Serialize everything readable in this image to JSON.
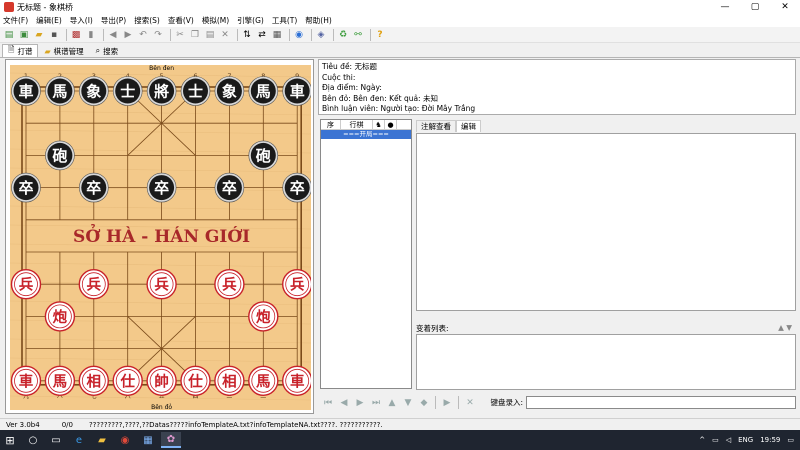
{
  "window": {
    "title": "无标题 - 象棋桥",
    "minimize": "—",
    "maximize": "▢",
    "close": "✕"
  },
  "menu": [
    "文件(F)",
    "编辑(E)",
    "导入(I)",
    "导出(P)",
    "搜索(S)",
    "查看(V)",
    "模拟(M)",
    "引擎(G)",
    "工具(T)",
    "帮助(H)"
  ],
  "toolbar_icons": [
    "new-icon",
    "open-icon",
    "folder-icon",
    "save-icon",
    "print-icon",
    "delete-icon",
    "back-icon",
    "forward-icon",
    "undo-icon",
    "redo-icon",
    "cut-icon",
    "copy-icon",
    "paste-icon",
    "clear-icon",
    "flip-vertical-icon",
    "flip-horizontal-icon",
    "board-icon",
    "play-icon",
    "engine-icon",
    "refresh-icon",
    "link-icon",
    "help-icon"
  ],
  "tabs": [
    {
      "label": "打谱",
      "icon": "page-icon"
    },
    {
      "label": "棋谱管理",
      "icon": "folder-icon"
    },
    {
      "label": "搜索",
      "icon": "search-icon"
    }
  ],
  "board": {
    "top_label": "Bên đen",
    "bottom_label": "Bên đỏ",
    "river_text": "SỞ HÀ - HÁN GIỚI",
    "top_files": [
      "1",
      "2",
      "3",
      "4",
      "5",
      "6",
      "7",
      "8",
      "9"
    ],
    "bottom_files": [
      "九",
      "八",
      "七",
      "六",
      "五",
      "四",
      "三",
      "二",
      "一"
    ],
    "pieces": [
      {
        "ch": "車",
        "side": "black",
        "file": 0,
        "rank": 0
      },
      {
        "ch": "馬",
        "side": "black",
        "file": 1,
        "rank": 0
      },
      {
        "ch": "象",
        "side": "black",
        "file": 2,
        "rank": 0
      },
      {
        "ch": "士",
        "side": "black",
        "file": 3,
        "rank": 0
      },
      {
        "ch": "將",
        "side": "black",
        "file": 4,
        "rank": 0
      },
      {
        "ch": "士",
        "side": "black",
        "file": 5,
        "rank": 0
      },
      {
        "ch": "象",
        "side": "black",
        "file": 6,
        "rank": 0
      },
      {
        "ch": "馬",
        "side": "black",
        "file": 7,
        "rank": 0
      },
      {
        "ch": "車",
        "side": "black",
        "file": 8,
        "rank": 0
      },
      {
        "ch": "砲",
        "side": "black",
        "file": 1,
        "rank": 2
      },
      {
        "ch": "砲",
        "side": "black",
        "file": 7,
        "rank": 2
      },
      {
        "ch": "卒",
        "side": "black",
        "file": 0,
        "rank": 3
      },
      {
        "ch": "卒",
        "side": "black",
        "file": 2,
        "rank": 3
      },
      {
        "ch": "卒",
        "side": "black",
        "file": 4,
        "rank": 3
      },
      {
        "ch": "卒",
        "side": "black",
        "file": 6,
        "rank": 3
      },
      {
        "ch": "卒",
        "side": "black",
        "file": 8,
        "rank": 3
      },
      {
        "ch": "兵",
        "side": "red",
        "file": 0,
        "rank": 6
      },
      {
        "ch": "兵",
        "side": "red",
        "file": 2,
        "rank": 6
      },
      {
        "ch": "兵",
        "side": "red",
        "file": 4,
        "rank": 6
      },
      {
        "ch": "兵",
        "side": "red",
        "file": 6,
        "rank": 6
      },
      {
        "ch": "兵",
        "side": "red",
        "file": 8,
        "rank": 6
      },
      {
        "ch": "炮",
        "side": "red",
        "file": 1,
        "rank": 7
      },
      {
        "ch": "炮",
        "side": "red",
        "file": 7,
        "rank": 7
      },
      {
        "ch": "車",
        "side": "red",
        "file": 0,
        "rank": 9
      },
      {
        "ch": "馬",
        "side": "red",
        "file": 1,
        "rank": 9
      },
      {
        "ch": "相",
        "side": "red",
        "file": 2,
        "rank": 9
      },
      {
        "ch": "仕",
        "side": "red",
        "file": 3,
        "rank": 9
      },
      {
        "ch": "帥",
        "side": "red",
        "file": 4,
        "rank": 9
      },
      {
        "ch": "仕",
        "side": "red",
        "file": 5,
        "rank": 9
      },
      {
        "ch": "相",
        "side": "red",
        "file": 6,
        "rank": 9
      },
      {
        "ch": "馬",
        "side": "red",
        "file": 7,
        "rank": 9
      },
      {
        "ch": "車",
        "side": "red",
        "file": 8,
        "rank": 9
      }
    ]
  },
  "info": {
    "line1": "Tiêu đề: 无标题",
    "line2": "Cuộc thi:",
    "line3": "Địa điểm:     Ngày:",
    "line4": "Bên đỏ:     Bên đen:     Kết quả: 未知",
    "line5": "Bình luận viên:     Người tạo: Đời Mây Trắng"
  },
  "movelist": {
    "headers": [
      "序",
      "行棋",
      "♞",
      "●"
    ],
    "first_row": "===开局==="
  },
  "comment": {
    "tabs": [
      "注解查看",
      "编辑"
    ],
    "variations_label": "变着列表:"
  },
  "nav": {
    "keyboard_label": "键盘录入:"
  },
  "status": {
    "version": "Ver 3.0b4",
    "count": "0/0",
    "message": "?????????,????,??Datas?????infoTemplateA.txt?infoTemplateNA.txt????. ???????????."
  },
  "taskbar": {
    "lang": "ENG",
    "time": "19:59"
  },
  "colors": {
    "board": "#f3c98a",
    "black_piece": "#1a1a1a",
    "red_piece": "#c8222a",
    "river_text": "#a8282a",
    "selection": "#3b74d3"
  }
}
